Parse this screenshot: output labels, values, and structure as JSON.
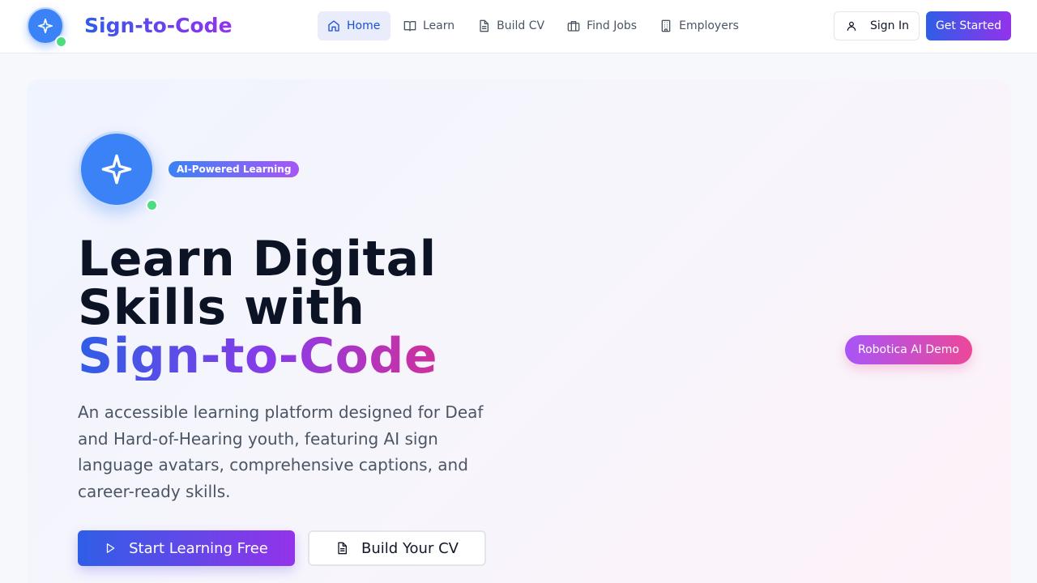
{
  "header": {
    "brand": "Sign-to-Code",
    "nav": [
      {
        "label": "Home",
        "icon": "home-icon",
        "active": true
      },
      {
        "label": "Learn",
        "icon": "book-icon"
      },
      {
        "label": "Build CV",
        "icon": "document-icon"
      },
      {
        "label": "Find Jobs",
        "icon": "briefcase-icon"
      },
      {
        "label": "Employers",
        "icon": "building-icon"
      }
    ],
    "sign_in": "Sign In",
    "get_started": "Get Started"
  },
  "hero": {
    "badge_label": "AI-Powered Learning",
    "headline_line1": "Learn Digital",
    "headline_line2": "Skills with",
    "headline_accent": "Sign-to-Code",
    "description": "An accessible learning platform designed for Deaf and Hard-of-Hearing youth, featuring AI sign language avatars, comprehensive captions, and career-ready skills.",
    "primary_button": "Start Learning Free",
    "secondary_button": "Build Your CV",
    "demo_label": "Robotica AI Demo"
  },
  "colors": {
    "primary_blue": "#3b82f6",
    "gradient_start": "#2f5ee6",
    "gradient_end": "#9333ea",
    "online_green": "#4ade80",
    "demo_pink": "#ec4899"
  }
}
